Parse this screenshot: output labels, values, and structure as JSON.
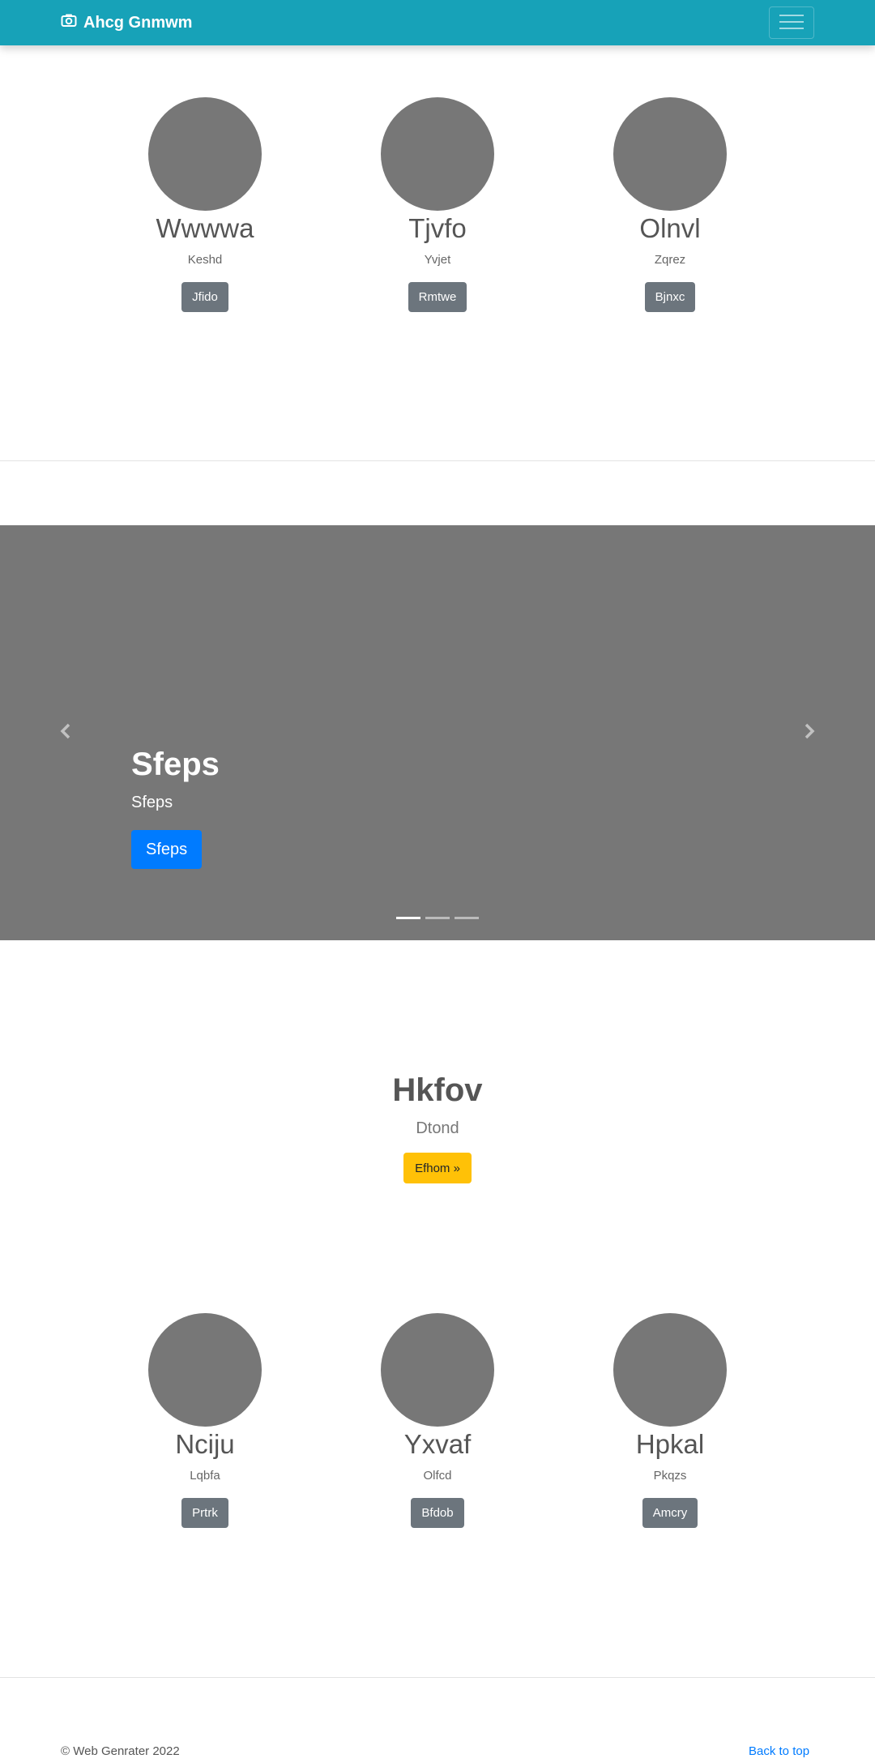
{
  "navbar": {
    "brand": "Ahcg Gnmwm",
    "brand_icon": "camera-icon",
    "toggler_icon": "hamburger-menu-icon",
    "bg_color": "#17a2b8"
  },
  "team_top": [
    {
      "name": "Wwwwa",
      "role": "Keshd",
      "button": "Jfido"
    },
    {
      "name": "Tjvfo",
      "role": "Yvjet",
      "button": "Rmtwe"
    },
    {
      "name": "Olnvl",
      "role": "Zqrez",
      "button": "Bjnxc"
    }
  ],
  "carousel": {
    "title": "Sfeps",
    "text": "Sfeps",
    "button": "Sfeps",
    "prev_icon": "chevron-left-icon",
    "next_icon": "chevron-right-icon",
    "slide_count": 3,
    "active_slide": 1
  },
  "feature": {
    "title": "Hkfov",
    "subtitle": "Dtond",
    "button": "Efhom »"
  },
  "team_bottom": [
    {
      "name": "Nciju",
      "role": "Lqbfa",
      "button": "Prtrk"
    },
    {
      "name": "Yxvaf",
      "role": "Olfcd",
      "button": "Bfdob"
    },
    {
      "name": "Hpkal",
      "role": "Pkqzs",
      "button": "Amcry"
    }
  ],
  "footer": {
    "copyright": "© Web Genrater 2022",
    "back_to_top": "Back to top"
  }
}
